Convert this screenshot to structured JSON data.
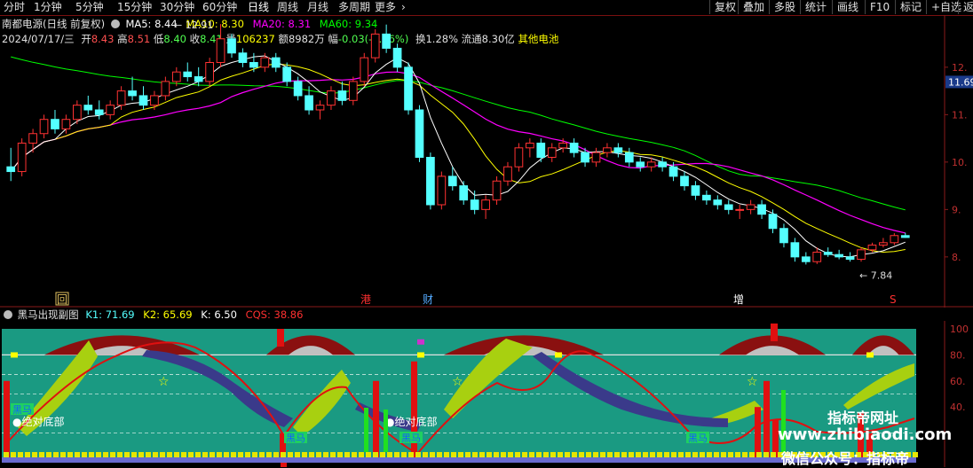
{
  "toolbar": {
    "periods": [
      "分时",
      "1分钟",
      "5分钟",
      "15分钟",
      "30分钟",
      "60分钟",
      "日线",
      "周线",
      "月线",
      "多周期",
      "更多"
    ],
    "active_period": "日线",
    "right_buttons": [
      "复权",
      "叠加",
      "多股",
      "统计",
      "画线",
      "F10",
      "标记",
      "+自选",
      "返"
    ]
  },
  "stock": {
    "title": "南都电源(日线 前复权)",
    "ma5": "MA5: 8.44",
    "ma10": "MA10: 8.30",
    "ma20": "MA20: 8.31",
    "ma60": "MA60: 9.34",
    "date": "2024/07/17/三",
    "open_l": "开",
    "open": "8.43",
    "high_l": "高",
    "high": "8.51",
    "low_l": "低",
    "low": "8.40",
    "close_l": "收",
    "close": "8.41",
    "vol_l": "量",
    "vol": "106237",
    "amt_l": "额",
    "amt": "8982万",
    "chg_l": "幅",
    "chg": "-0.03(-0.36%)",
    "turnover": "换1.28%",
    "float_cap": "流通8.30亿",
    "concept": "其他电池"
  },
  "price_axis": {
    "ticks": [
      "12.",
      "11.69",
      "11.",
      "10.",
      "9.",
      "8."
    ],
    "current": "11.69",
    "high_mark": "12.91",
    "low_mark": "7.84"
  },
  "markers": {
    "hui": "回",
    "gang": "港",
    "cai": "财",
    "zeng": "增",
    "s": "S"
  },
  "indicator": {
    "name": "黑马出现副图",
    "k1": "K1: 71.69",
    "k2": "K2: 65.69",
    "k": "K: 6.50",
    "cqs": "CQS: 38.86",
    "axis": [
      "100",
      "80.",
      "60.",
      "40."
    ],
    "label_bottom": "绝对底部",
    "label_heima": "黑马"
  },
  "watermark": {
    "line1": "指标帝网址",
    "line2": "www.zhibiaodi.com",
    "line3": "微信公众号：指标帝"
  },
  "colors": {
    "up": "#ff3232",
    "down": "#54ffff",
    "ma5": "#ffffff",
    "ma10": "#ffff00",
    "ma20": "#ff00ff",
    "ma60": "#00ff00",
    "teal": "#1a9a82"
  },
  "chart_data": {
    "type": "candlestick",
    "candles": [
      [
        9.9,
        10.3,
        9.6,
        9.8
      ],
      [
        9.8,
        10.5,
        9.7,
        10.4
      ],
      [
        10.4,
        10.7,
        10.2,
        10.6
      ],
      [
        10.6,
        11.0,
        10.5,
        10.9
      ],
      [
        10.9,
        11.1,
        10.6,
        10.7
      ],
      [
        10.7,
        11.0,
        10.6,
        10.9
      ],
      [
        10.9,
        11.3,
        10.8,
        11.2
      ],
      [
        11.2,
        11.4,
        11.0,
        11.1
      ],
      [
        11.1,
        11.3,
        10.9,
        11.0
      ],
      [
        11.0,
        11.3,
        10.9,
        11.2
      ],
      [
        11.2,
        11.6,
        11.1,
        11.5
      ],
      [
        11.5,
        11.8,
        11.3,
        11.4
      ],
      [
        11.4,
        11.6,
        11.1,
        11.2
      ],
      [
        11.2,
        11.5,
        11.1,
        11.4
      ],
      [
        11.4,
        11.8,
        11.3,
        11.7
      ],
      [
        11.7,
        12.0,
        11.6,
        11.9
      ],
      [
        11.9,
        12.1,
        11.7,
        11.8
      ],
      [
        11.8,
        12.0,
        11.6,
        11.7
      ],
      [
        11.7,
        12.2,
        11.6,
        12.1
      ],
      [
        12.1,
        12.91,
        12.0,
        12.6
      ],
      [
        12.6,
        12.7,
        12.2,
        12.3
      ],
      [
        12.3,
        12.4,
        12.0,
        12.1
      ],
      [
        12.1,
        12.3,
        11.9,
        12.0
      ],
      [
        12.0,
        12.3,
        11.9,
        12.2
      ],
      [
        12.2,
        12.3,
        11.9,
        12.0
      ],
      [
        12.0,
        12.1,
        11.6,
        11.7
      ],
      [
        11.7,
        11.8,
        11.3,
        11.4
      ],
      [
        11.4,
        11.6,
        11.0,
        11.1
      ],
      [
        11.1,
        11.3,
        10.9,
        11.2
      ],
      [
        11.2,
        11.6,
        11.1,
        11.5
      ],
      [
        11.5,
        11.7,
        11.2,
        11.3
      ],
      [
        11.3,
        11.8,
        11.2,
        11.7
      ],
      [
        11.7,
        12.3,
        11.6,
        12.2
      ],
      [
        12.2,
        12.8,
        12.1,
        12.7
      ],
      [
        12.7,
        12.9,
        12.3,
        12.4
      ],
      [
        12.4,
        12.5,
        11.9,
        12.0
      ],
      [
        12.0,
        12.1,
        11.0,
        11.1
      ],
      [
        11.1,
        11.2,
        10.0,
        10.1
      ],
      [
        10.1,
        10.2,
        9.0,
        9.1
      ],
      [
        9.1,
        9.8,
        9.0,
        9.7
      ],
      [
        9.7,
        9.9,
        9.4,
        9.5
      ],
      [
        9.5,
        9.6,
        9.1,
        9.2
      ],
      [
        9.2,
        9.4,
        8.9,
        9.0
      ],
      [
        9.0,
        9.3,
        8.8,
        9.2
      ],
      [
        9.2,
        9.7,
        9.1,
        9.6
      ],
      [
        9.6,
        10.0,
        9.5,
        9.9
      ],
      [
        9.9,
        10.4,
        9.8,
        10.3
      ],
      [
        10.3,
        10.5,
        10.1,
        10.4
      ],
      [
        10.4,
        10.5,
        10.0,
        10.1
      ],
      [
        10.1,
        10.4,
        10.0,
        10.3
      ],
      [
        10.3,
        10.5,
        10.2,
        10.4
      ],
      [
        10.4,
        10.5,
        10.1,
        10.2
      ],
      [
        10.2,
        10.3,
        9.9,
        10.0
      ],
      [
        10.0,
        10.3,
        9.9,
        10.2
      ],
      [
        10.2,
        10.4,
        10.1,
        10.3
      ],
      [
        10.3,
        10.4,
        10.1,
        10.2
      ],
      [
        10.2,
        10.3,
        9.9,
        10.0
      ],
      [
        10.0,
        10.1,
        9.8,
        9.9
      ],
      [
        9.9,
        10.1,
        9.8,
        10.0
      ],
      [
        10.0,
        10.1,
        9.8,
        9.9
      ],
      [
        9.9,
        10.0,
        9.6,
        9.7
      ],
      [
        9.7,
        9.8,
        9.4,
        9.5
      ],
      [
        9.5,
        9.6,
        9.2,
        9.3
      ],
      [
        9.3,
        9.4,
        9.1,
        9.2
      ],
      [
        9.2,
        9.3,
        9.0,
        9.1
      ],
      [
        9.1,
        9.2,
        8.9,
        9.0
      ],
      [
        9.0,
        9.1,
        8.8,
        9.0
      ],
      [
        9.0,
        9.2,
        8.9,
        9.1
      ],
      [
        9.1,
        9.2,
        8.8,
        8.9
      ],
      [
        8.9,
        9.0,
        8.5,
        8.6
      ],
      [
        8.6,
        8.7,
        8.2,
        8.3
      ],
      [
        8.3,
        8.4,
        7.9,
        8.0
      ],
      [
        8.0,
        8.1,
        7.84,
        7.9
      ],
      [
        7.9,
        8.2,
        7.85,
        8.1
      ],
      [
        8.1,
        8.2,
        8.0,
        8.05
      ],
      [
        8.05,
        8.15,
        7.95,
        8.0
      ],
      [
        8.0,
        8.1,
        7.9,
        7.95
      ],
      [
        7.95,
        8.2,
        7.9,
        8.15
      ],
      [
        8.15,
        8.3,
        8.1,
        8.25
      ],
      [
        8.25,
        8.4,
        8.2,
        8.3
      ],
      [
        8.3,
        8.5,
        8.25,
        8.45
      ],
      [
        8.45,
        8.51,
        8.4,
        8.41
      ]
    ]
  }
}
